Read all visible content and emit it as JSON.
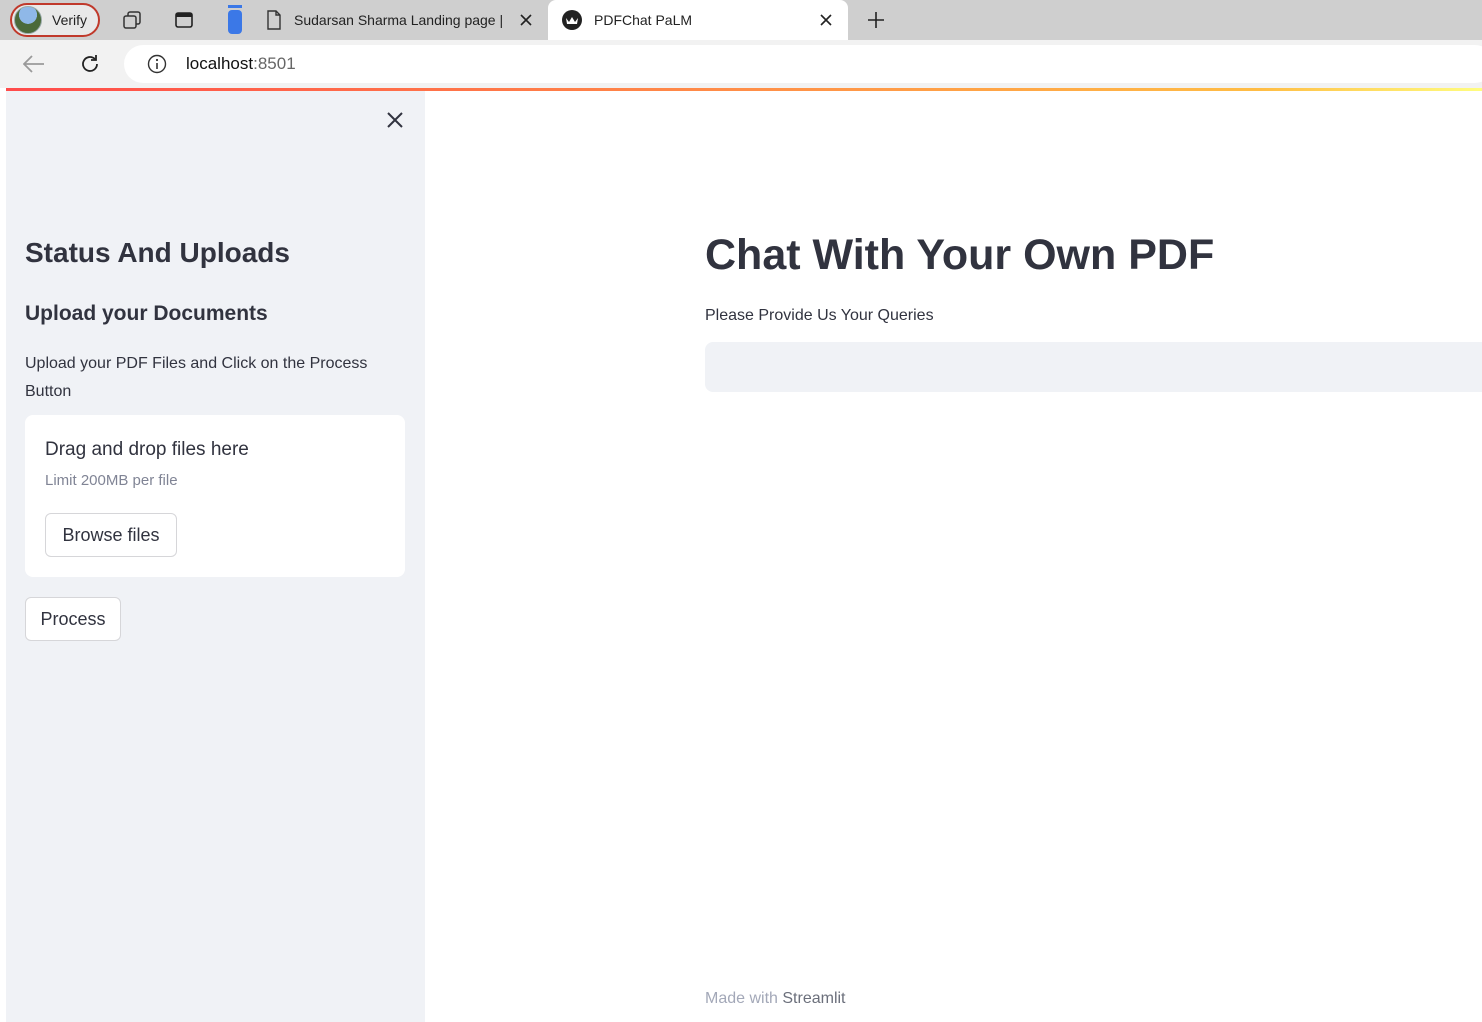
{
  "browser": {
    "profile_label": "Verify",
    "tabs": [
      {
        "title": "Sudarsan Sharma Landing page |",
        "active": false
      },
      {
        "title": "PDFChat PaLM",
        "active": true
      }
    ],
    "url_host": "localhost",
    "url_port": ":8501",
    "icons": [
      "workspaces-icon",
      "tab-actions-icon",
      "page-icon",
      "streamlit-icon",
      "close-icon",
      "plus-icon",
      "back-arrow-icon",
      "reload-icon",
      "info-icon"
    ]
  },
  "sidebar": {
    "title": "Status And Uploads",
    "subtitle": "Upload your Documents",
    "description": "Upload your PDF Files and Click on the Process Button",
    "uploader": {
      "instruction": "Drag and drop files here",
      "limit": "Limit 200MB per file",
      "browse_label": "Browse files"
    },
    "process_label": "Process"
  },
  "main": {
    "title": "Chat With Your Own PDF",
    "query_label": "Please Provide Us Your Queries",
    "query_value": ""
  },
  "footer": {
    "prefix": "Made with",
    "brand": "Streamlit"
  },
  "colors": {
    "sidebar_bg": "#f0f2f6",
    "text": "#31333f",
    "accent_start": "#ff4b4b",
    "accent_end": "#ffbd45"
  }
}
